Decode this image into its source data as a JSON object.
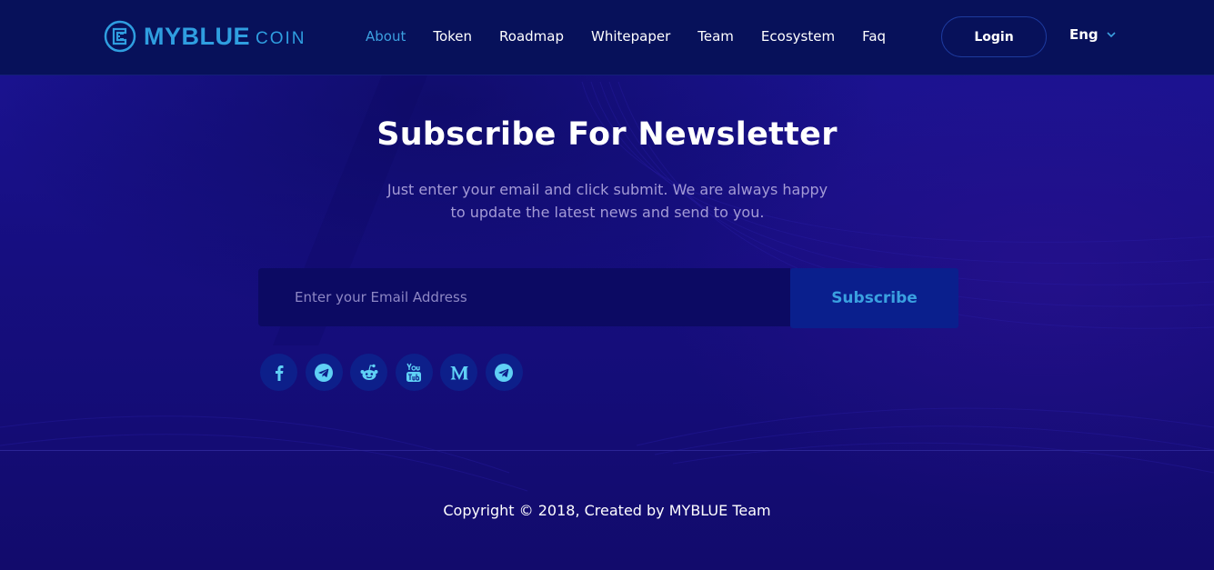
{
  "brand": {
    "name": "MYBLUE",
    "suffix": "COIN"
  },
  "nav": {
    "items": [
      {
        "label": "About",
        "active": true
      },
      {
        "label": "Token"
      },
      {
        "label": "Roadmap"
      },
      {
        "label": "Whitepaper"
      },
      {
        "label": "Team"
      },
      {
        "label": "Ecosystem"
      },
      {
        "label": "Faq"
      }
    ],
    "login_label": "Login",
    "language": "Eng"
  },
  "newsletter": {
    "title": "Subscribe For Newsletter",
    "description_line1": "Just enter your email and click submit. We are always happy",
    "description_line2": "to update the latest news and send to you.",
    "email_placeholder": "Enter your Email Address",
    "email_value": "",
    "submit_label": "Subscribe"
  },
  "socials": [
    {
      "icon": "facebook-icon"
    },
    {
      "icon": "telegram-icon"
    },
    {
      "icon": "reddit-icon"
    },
    {
      "icon": "youtube-icon"
    },
    {
      "icon": "medium-icon"
    },
    {
      "icon": "telegram-icon"
    }
  ],
  "footer": {
    "copyright": "Copyright © 2018, Created by MYBLUE Team"
  },
  "colors": {
    "accent": "#3ca0e0",
    "header_bg": "#07115a",
    "page_bg": "#170f7a",
    "icon_color": "#5fd0f5"
  }
}
